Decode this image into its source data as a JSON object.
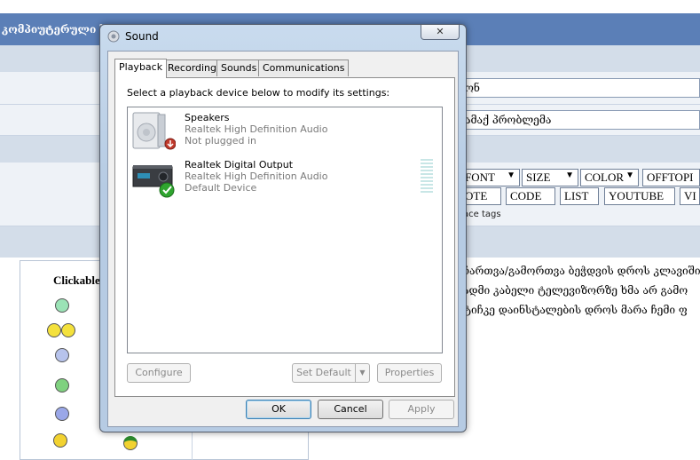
{
  "forum": {
    "title": "კომპიუტერული ს",
    "subject_value": "ონ",
    "subject2_value": "ამაქ პრობლემა",
    "bbcode_row1": [
      "FONT",
      "SIZE",
      "COLOR",
      "OFFTOPI"
    ],
    "bbcode_row2": [
      "OTE",
      "CODE",
      "LIST",
      "YOUTUBE",
      "VI"
    ],
    "bbcode_hint": "ace tags",
    "clickable_label": "Clickable",
    "post_lines": [
      "ჩართვა/გამორთვა ბეჭდვის დროს კლავიში",
      "ადმი კაბელი ტელევიზორზე ხმა არ გამო",
      "ტიჩკე დაინსტალების დროს მარა ჩემი ფ"
    ]
  },
  "dialog": {
    "title": "Sound",
    "close_glyph": "✕",
    "tabs": [
      {
        "label": "Playback",
        "active": true
      },
      {
        "label": "Recording",
        "active": false
      },
      {
        "label": "Sounds",
        "active": false
      },
      {
        "label": "Communications",
        "active": false
      }
    ],
    "instruction": "Select a playback device below to modify its settings:",
    "devices": [
      {
        "name": "Speakers",
        "driver": "Realtek High Definition Audio",
        "status": "Not plugged in",
        "icon": "speaker-icon",
        "badge": "unplugged-badge"
      },
      {
        "name": "Realtek Digital Output",
        "driver": "Realtek High Definition Audio",
        "status": "Default Device",
        "icon": "digital-output-icon",
        "badge": "default-check-badge"
      }
    ],
    "buttons": {
      "configure": "Configure",
      "set_default": "Set Default",
      "properties": "Properties",
      "ok": "OK",
      "cancel": "Cancel",
      "apply": "Apply"
    },
    "colors": {
      "accent": "#3c7fb1",
      "check": "#2fa52f",
      "unplugged": "#c0392b",
      "meter": "#c8e6e6"
    }
  }
}
